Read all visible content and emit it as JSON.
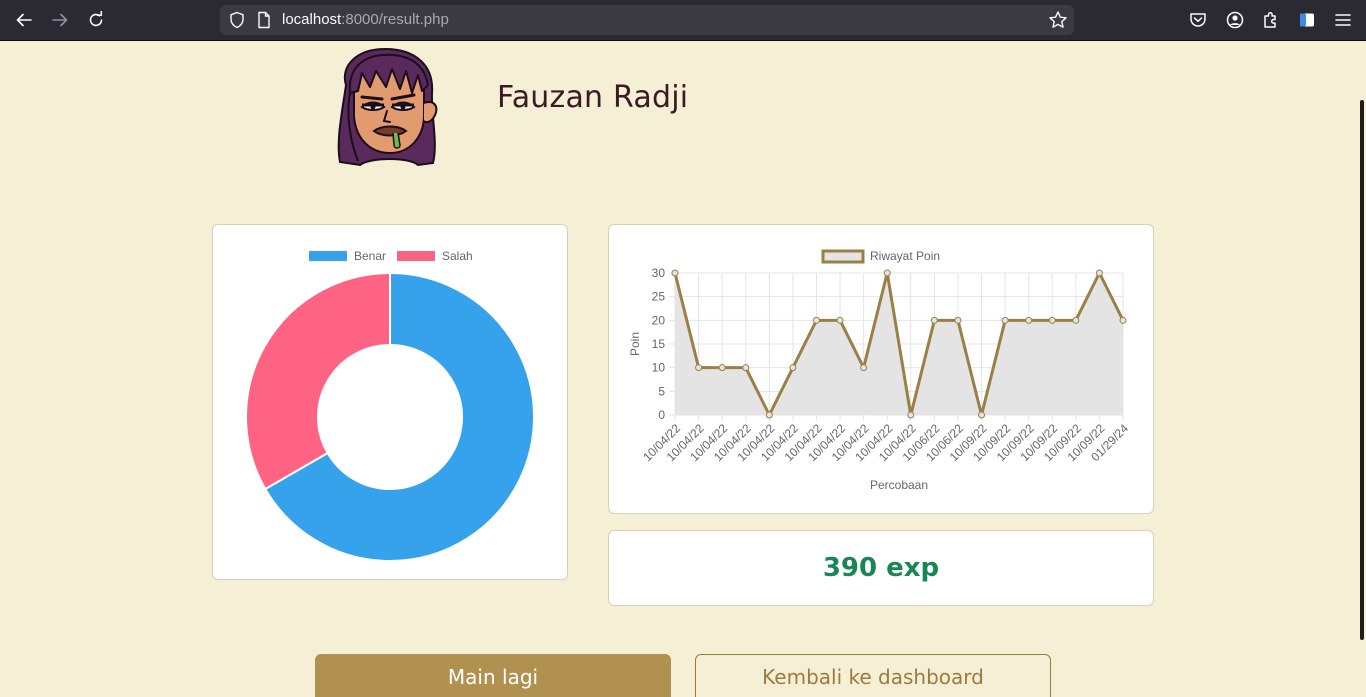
{
  "browser": {
    "url_host": "localhost",
    "url_path": ":8000/result.php"
  },
  "profile": {
    "name": "Fauzan Radji"
  },
  "donut_chart": {
    "type": "pie",
    "legend": [
      "Benar",
      "Salah"
    ],
    "colors": [
      "#36a2eb",
      "#ff6384"
    ],
    "values": [
      2,
      1
    ]
  },
  "chart_data": {
    "type": "area",
    "title": "",
    "legend": [
      "Riwayat Poin"
    ],
    "xlabel": "Percobaan",
    "ylabel": "Poin",
    "ylim": [
      0,
      30
    ],
    "yticks": [
      0,
      5,
      10,
      15,
      20,
      25,
      30
    ],
    "grid": true,
    "categories": [
      "10/04/22",
      "10/04/22",
      "10/04/22",
      "10/04/22",
      "10/04/22",
      "10/04/22",
      "10/04/22",
      "10/04/22",
      "10/04/22",
      "10/04/22",
      "10/04/22",
      "10/06/22",
      "10/06/22",
      "10/09/22",
      "10/09/22",
      "10/09/22",
      "10/09/22",
      "10/09/22",
      "10/09/22",
      "01/29/24"
    ],
    "series": [
      {
        "name": "Riwayat Poin",
        "values": [
          30,
          10,
          10,
          10,
          0,
          10,
          20,
          20,
          10,
          30,
          0,
          20,
          20,
          0,
          20,
          20,
          20,
          20,
          30,
          20
        ]
      }
    ],
    "line_color": "#9a8045",
    "fill_color": "#e4e4e4"
  },
  "exp": {
    "text": "390 exp"
  },
  "buttons": {
    "play_again": "Main lagi",
    "back_dashboard": "Kembali ke dashboard"
  },
  "icons": [
    "back-arrow-icon",
    "forward-arrow-icon",
    "reload-icon",
    "shield-icon",
    "page-icon",
    "bookmark-star-icon",
    "pocket-icon",
    "account-icon",
    "extensions-icon",
    "sidebar-icon",
    "menu-icon"
  ]
}
